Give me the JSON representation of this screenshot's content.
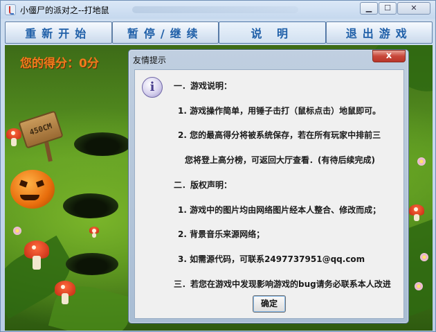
{
  "window": {
    "title": "小僵尸的派对之--打地鼠"
  },
  "menu": {
    "restart": "重新开始",
    "pause_resume": "暂停/继续",
    "instructions": "说  明",
    "exit": "退出游戏"
  },
  "game": {
    "score_text": "您的得分：0分",
    "sign_text": "450CM"
  },
  "dialog": {
    "title": "友情提示",
    "close_label": "x",
    "lines": [
      "一．游戏说明：",
      "1. 游戏操作简单，用锤子击打（鼠标点击）地鼠即可。",
      "2. 您的最高得分将被系统保存，若在所有玩家中排前三",
      "您将登上高分榜，可返回大厅查看．(有待后续完成)",
      "二．版权声明：",
      "1. 游戏中的图片均由网络图片经本人整合、修改而成；",
      "2. 背景音乐来源网络；",
      "3. 如需源代码，可联系2497737951@qq.com",
      "三．若您在游戏中发现影响游戏的bug请务必联系本人改进"
    ],
    "ok_label": "确定"
  },
  "colors": {
    "menu_text": "#1f5fa8",
    "score_text": "#f07b1c",
    "dialog_close": "#c8473a"
  }
}
